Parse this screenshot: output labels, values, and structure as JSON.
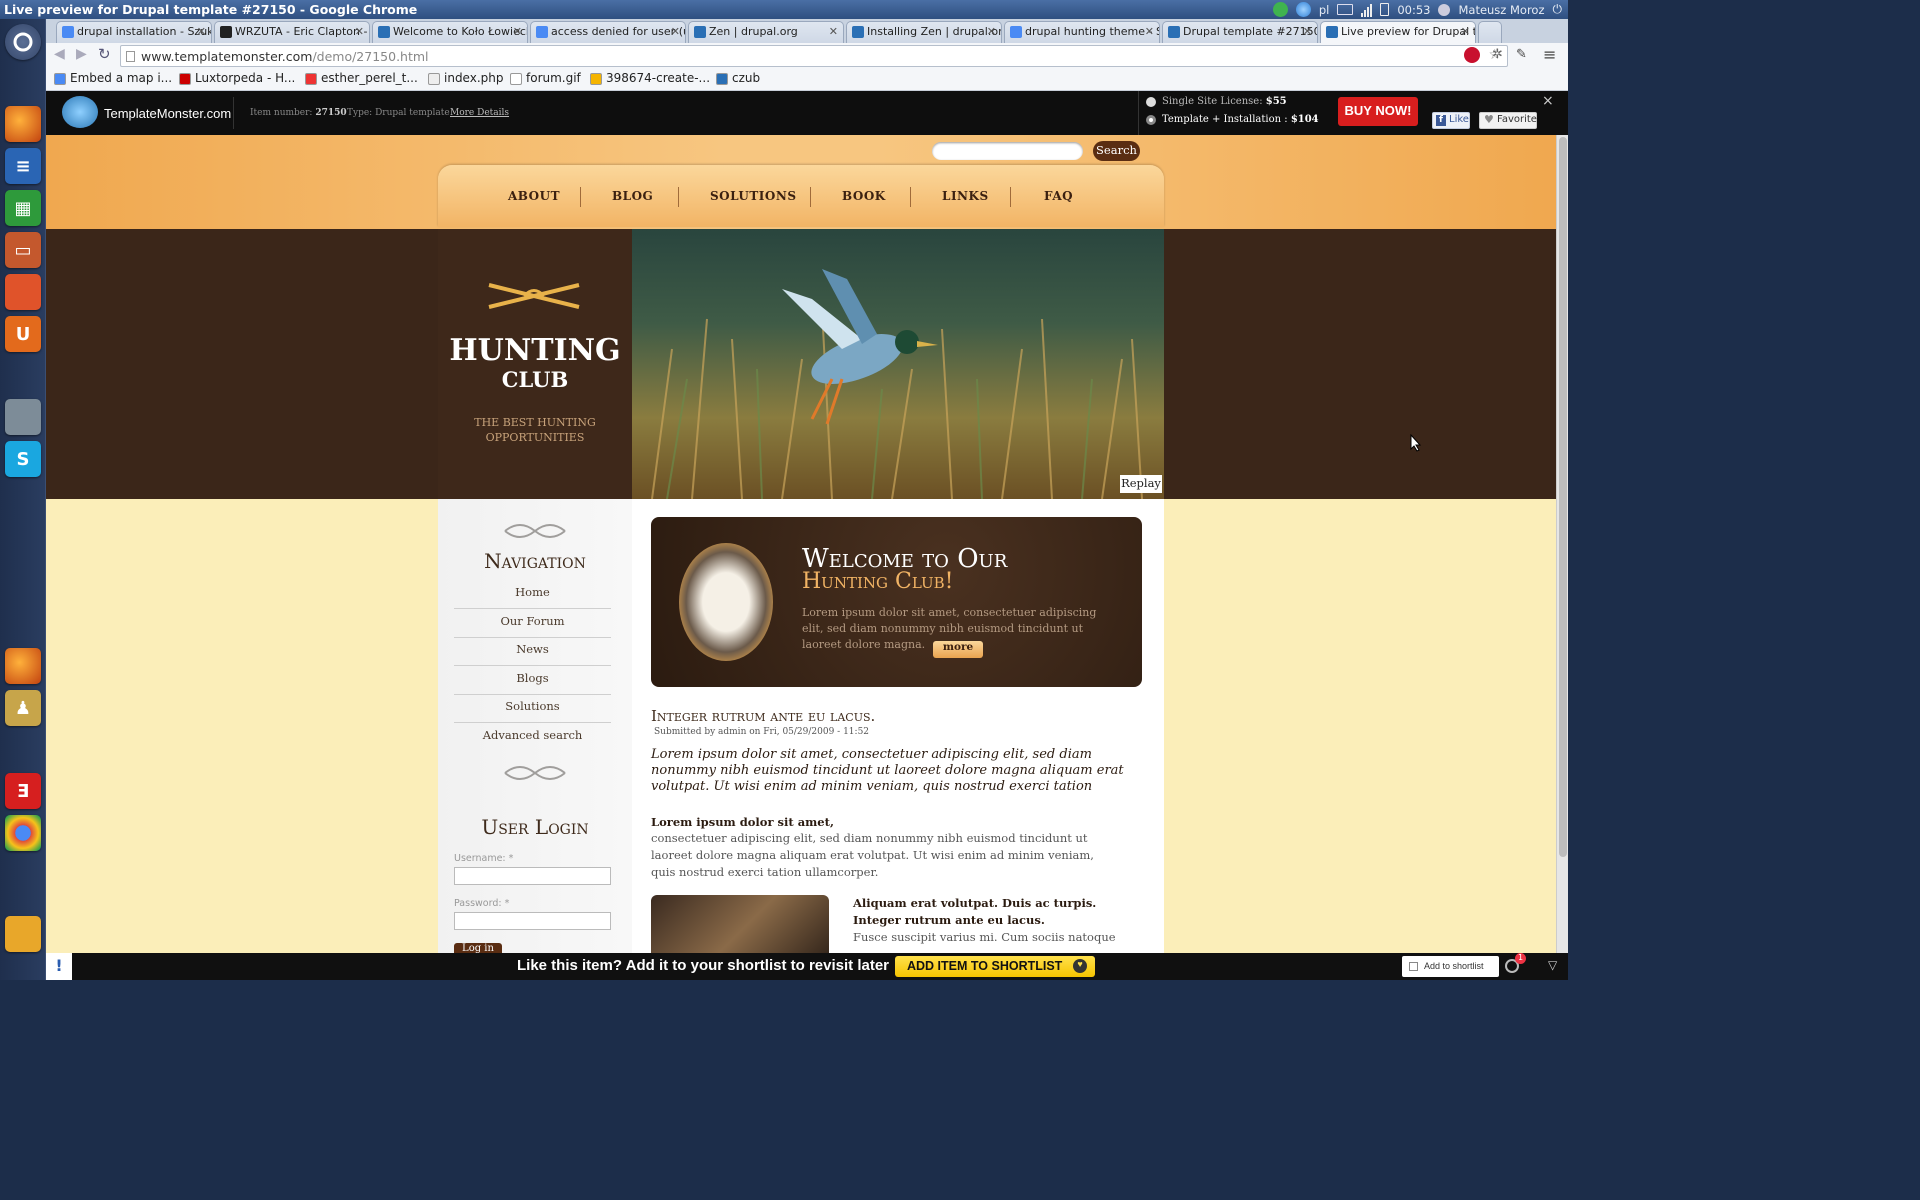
{
  "window": {
    "title": "Live preview for Drupal template #27150 - Google Chrome"
  },
  "tray": {
    "lang": "pl",
    "time": "00:53",
    "user": "Mateusz Moroz"
  },
  "tabs": [
    {
      "label": "drupal installation - Szuka"
    },
    {
      "label": "WRZUTA - Eric Clapton - n"
    },
    {
      "label": "Welcome to Koło Łowieck"
    },
    {
      "label": "access denied for user (u"
    },
    {
      "label": "Zen | drupal.org"
    },
    {
      "label": "Installing Zen | drupal.org"
    },
    {
      "label": "drupal hunting theme - Sz"
    },
    {
      "label": "Drupal template #27150"
    },
    {
      "label": "Live preview for Drupal te"
    }
  ],
  "omnibox": {
    "url_host": "www.templatemonster.com",
    "url_path": "/demo/27150.html"
  },
  "bookmarks": [
    "Embed a map i...",
    "Luxtorpeda - H...",
    "esther_perel_t...",
    "index.php",
    "forum.gif",
    "398674-create-...",
    "czub"
  ],
  "tm": {
    "logo": "TemplateMonster.com",
    "item_label": "Item number:",
    "item_value": "27150",
    "type_label": "Type:",
    "type_value": "Drupal template",
    "more": "More Details",
    "license1_label": "Single Site License:",
    "license1_price": "$55",
    "license2_label": "Template + Installation :",
    "license2_price": "$104",
    "buy": "BUY NOW!",
    "like": "Like",
    "favorite": "Favorite",
    "close": "×"
  },
  "site": {
    "search_btn": "Search",
    "menu": [
      "ABOUT",
      "BLOG",
      "SOLUTIONS",
      "BOOK",
      "LINKS",
      "FAQ"
    ],
    "logo_line1": "HUNTING",
    "logo_line2": "CLUB",
    "tagline1": "THE BEST HUNTING",
    "tagline2": "OPPORTUNITIES",
    "replay": "Replay",
    "nav_title": "Navigation",
    "nav_links": [
      "Home",
      "Our Forum",
      "News",
      "Blogs",
      "Solutions",
      "Advanced search"
    ],
    "login_title": "User Login",
    "username_label": "Username: *",
    "password_label": "Password: *",
    "login_btn": "Log in",
    "welcome_line1": "Welcome to Our",
    "welcome_line2": "Hunting Club!",
    "welcome_text": "Lorem ipsum dolor sit amet, consectetuer adipiscing elit, sed diam nonummy nibh euismod tincidunt ut laoreet dolore magna.",
    "more": "more",
    "post_title": "Integer rutrum ante eu lacus.",
    "post_meta": "Submitted by admin on Fri, 05/29/2009 - 11:52",
    "post_intro": "Lorem ipsum dolor sit amet, consectetuer adipiscing elit, sed diam nonummy nibh euismod tincidunt ut laoreet dolore magna aliquam erat volutpat. Ut wisi enim ad minim veniam, quis nostrud exerci tation",
    "post_bold": "Lorem ipsum dolor sit amet,",
    "post_body": "consectetuer adipiscing elit, sed diam nonummy nibh euismod tincidunt ut laoreet dolore magna aliquam erat volutpat. Ut wisi enim ad minim veniam, quis nostrud exerci tation ullamcorper.",
    "aside_bold": "Aliquam erat volutpat. Duis ac turpis. Integer rutrum ante eu lacus.",
    "aside_text": "Fusce suscipit varius mi. Cum sociis natoque"
  },
  "bottom": {
    "message": "Like this item? Add it to your shortlist to revisit later",
    "shortlist_btn": "ADD ITEM TO SHORTLIST",
    "add_to_shortlist": "Add to shortlist",
    "badge": "1",
    "excl": "!"
  }
}
